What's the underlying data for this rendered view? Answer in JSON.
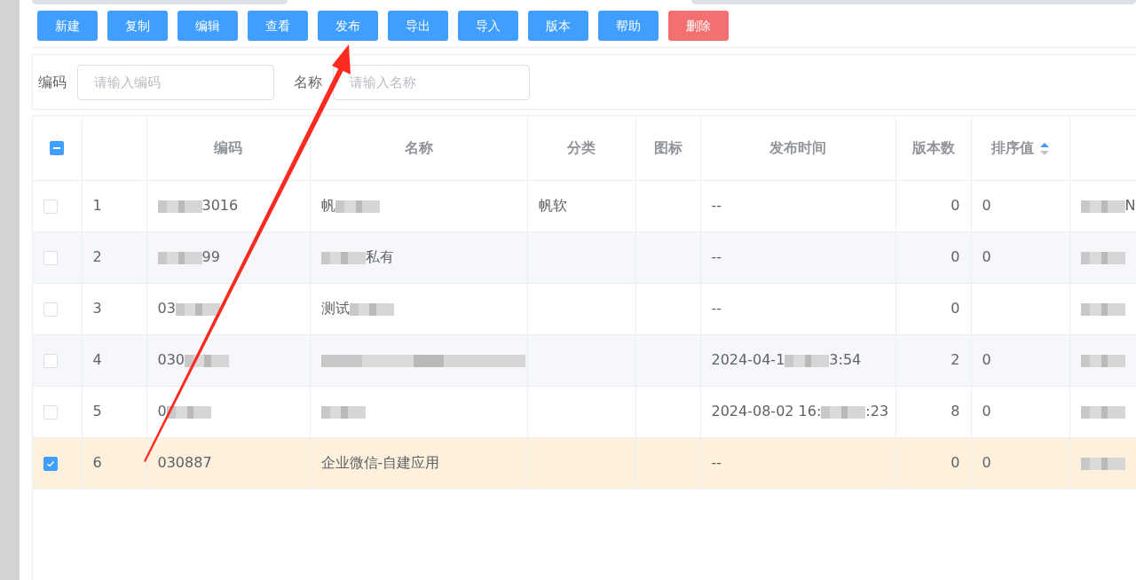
{
  "toolbar": [
    {
      "label": "新建",
      "kind": "primary"
    },
    {
      "label": "复制",
      "kind": "primary"
    },
    {
      "label": "编辑",
      "kind": "primary"
    },
    {
      "label": "查看",
      "kind": "primary"
    },
    {
      "label": "发布",
      "kind": "primary"
    },
    {
      "label": "导出",
      "kind": "primary"
    },
    {
      "label": "导入",
      "kind": "primary"
    },
    {
      "label": "版本",
      "kind": "primary"
    },
    {
      "label": "帮助",
      "kind": "primary"
    },
    {
      "label": "删除",
      "kind": "danger"
    }
  ],
  "filters": [
    {
      "label": "编码",
      "placeholder": "请输入编码"
    },
    {
      "label": "名称",
      "placeholder": "请输入名称"
    }
  ],
  "table": {
    "select_all": {
      "indeterminate": true
    },
    "columns": [
      {
        "kind": "index"
      },
      {
        "kind": "text",
        "label": "编码"
      },
      {
        "kind": "text",
        "label": "名称"
      },
      {
        "kind": "text",
        "label": "分类"
      },
      {
        "kind": "text",
        "label": "图标"
      },
      {
        "kind": "text",
        "label": "发布时间"
      },
      {
        "kind": "number",
        "label": "版本数"
      },
      {
        "kind": "text",
        "label": "排序值",
        "sort_ascending": true
      },
      {
        "kind": "text"
      }
    ],
    "rows": [
      {
        "selected": false,
        "cells": [
          {
            "text": "1"
          },
          {
            "redacted": true,
            "after": "3016"
          },
          {
            "before": "帆",
            "redacted": true
          },
          {
            "text": "帆软"
          },
          null,
          {
            "text": "--"
          },
          {
            "text": "0"
          },
          {
            "text": "0"
          },
          {
            "redacted": true,
            "after": "N"
          }
        ]
      },
      {
        "selected": false,
        "cells": [
          {
            "text": "2"
          },
          {
            "redacted": true,
            "after": "99"
          },
          {
            "redacted": true,
            "after": "私有"
          },
          null,
          null,
          {
            "text": "--"
          },
          {
            "text": "0"
          },
          {
            "text": "0"
          },
          {
            "redacted": true
          }
        ]
      },
      {
        "selected": false,
        "cells": [
          {
            "text": "3"
          },
          {
            "before": "03",
            "redacted": true
          },
          {
            "before": "测试",
            "redacted": true
          },
          null,
          null,
          {
            "text": "--"
          },
          {
            "text": "0"
          },
          null,
          {
            "redacted": true
          }
        ]
      },
      {
        "selected": false,
        "cells": [
          {
            "text": "4"
          },
          {
            "before": "030",
            "redacted": true
          },
          {
            "redacted": true,
            "wide": true
          },
          null,
          null,
          {
            "before": "2024-04-1",
            "redacted": true,
            "after": "3:54"
          },
          {
            "text": "2"
          },
          {
            "text": "0"
          },
          {
            "redacted": true
          }
        ]
      },
      {
        "selected": false,
        "cells": [
          {
            "text": "5"
          },
          {
            "before": "0",
            "redacted": true
          },
          {
            "redacted": true
          },
          null,
          null,
          {
            "before": "2024-08-02 16:",
            "redacted": true,
            "after": ":23"
          },
          {
            "text": "8"
          },
          {
            "text": "0"
          },
          {
            "redacted": true
          }
        ]
      },
      {
        "selected": true,
        "cells": [
          {
            "text": "6"
          },
          {
            "text": "030887"
          },
          {
            "text": "企业微信-自建应用"
          },
          null,
          null,
          {
            "text": "--"
          },
          {
            "text": "0"
          },
          {
            "text": "0"
          },
          {
            "redacted": true
          }
        ]
      }
    ]
  },
  "overlays": [
    {
      "kind": "arrow"
    }
  ]
}
